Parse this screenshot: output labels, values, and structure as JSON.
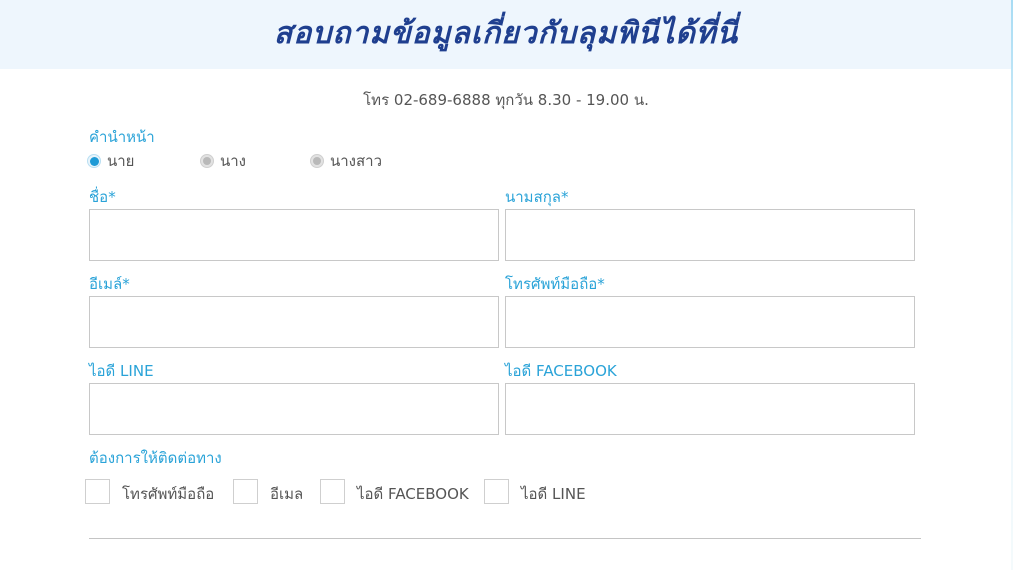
{
  "header": {
    "title": "สอบถามข้อมูลเกี่ยวกับลุมพินีได้ที่นี่"
  },
  "contact_info": "โทร 02-689-6888 ทุกวัน 8.30 - 19.00 น.",
  "form": {
    "title_prefix": {
      "label": "คำนำหน้า",
      "options": [
        {
          "label": "นาย",
          "checked": true
        },
        {
          "label": "นาง",
          "checked": false
        },
        {
          "label": "นางสาว",
          "checked": false
        }
      ]
    },
    "fields": {
      "first_name": {
        "label": "ชื่อ*",
        "value": "",
        "placeholder": ""
      },
      "last_name": {
        "label": "นามสกุล*",
        "value": "",
        "placeholder": ""
      },
      "email": {
        "label": "อีเมล์*",
        "value": "",
        "placeholder": ""
      },
      "mobile": {
        "label": "โทรศัพท์มือถือ*",
        "value": "",
        "placeholder": ""
      },
      "line_id": {
        "label": "ไอดี LINE",
        "value": "",
        "placeholder": ""
      },
      "facebook_id": {
        "label": "ไอดี FACEBOOK",
        "value": "",
        "placeholder": ""
      }
    },
    "contact_preference": {
      "label": "ต้องการให้ติดต่อทาง",
      "options": [
        {
          "label": "โทรศัพท์มือถือ",
          "checked": false
        },
        {
          "label": "อีเมล",
          "checked": false
        },
        {
          "label": "ไอดี FACEBOOK",
          "checked": false
        },
        {
          "label": "ไอดี LINE",
          "checked": false
        }
      ]
    }
  },
  "colors": {
    "accent": "#2aa3d8",
    "title": "#1f3f8f",
    "header_bg": "#eef6fd",
    "border": "#c8c8c8"
  }
}
